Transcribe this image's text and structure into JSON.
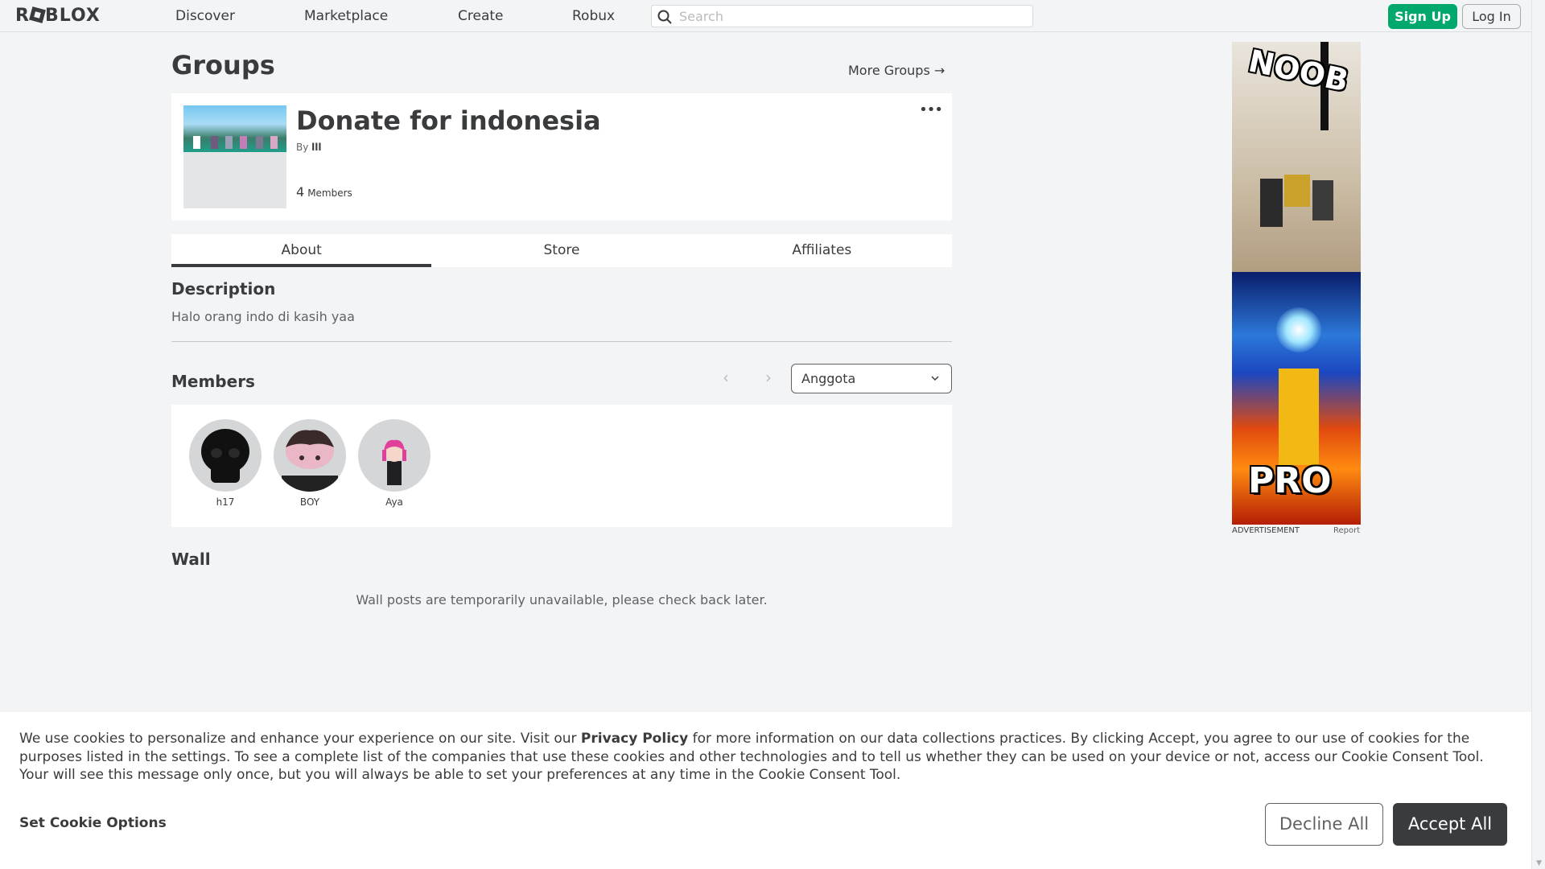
{
  "nav": {
    "logo": "ROBLOX",
    "links": [
      "Discover",
      "Marketplace",
      "Create",
      "Robux"
    ],
    "search_placeholder": "Search",
    "signup": "Sign Up",
    "login": "Log In"
  },
  "page": {
    "title": "Groups",
    "more_groups": "More Groups →"
  },
  "group": {
    "name": "Donate for indonesia",
    "by_label": "By",
    "owner": "lll",
    "member_count": "4",
    "members_label": "Members"
  },
  "tabs": [
    "About",
    "Store",
    "Affiliates"
  ],
  "about": {
    "description_heading": "Description",
    "description": "Halo orang indo di kasih yaa",
    "members_heading": "Members",
    "role_selected": "Anggota",
    "members": [
      {
        "name": "h17"
      },
      {
        "name": "BOY"
      },
      {
        "name": "Aya"
      }
    ],
    "wall_heading": "Wall",
    "wall_message": "Wall posts are temporarily unavailable, please check back later."
  },
  "ad": {
    "label": "ADVERTISEMENT",
    "report": "Report",
    "top_text": "NOOB",
    "bottom_text": "PRO"
  },
  "cookie": {
    "text_before": "We use cookies to personalize and enhance your experience on our site. Visit our",
    "link": "Privacy Policy",
    "text_after": "for more information on our data collections practices. By clicking Accept, you agree to our use of cookies for the purposes listed in the settings. To see a complete list of the companies that use these cookies and other technologies and to tell us whether they can be used on your device or not, access our Cookie Consent Tool. Your will see this message only once, but you will always be able to set your preferences at any time in the Cookie Consent Tool.",
    "set_options": "Set Cookie Options",
    "decline": "Decline All",
    "accept": "Accept All"
  },
  "colors": {
    "background": "#f2f4f5",
    "signup_green": "#00a86b",
    "text_dark": "#393b3d",
    "accept_button": "#393b3d"
  }
}
